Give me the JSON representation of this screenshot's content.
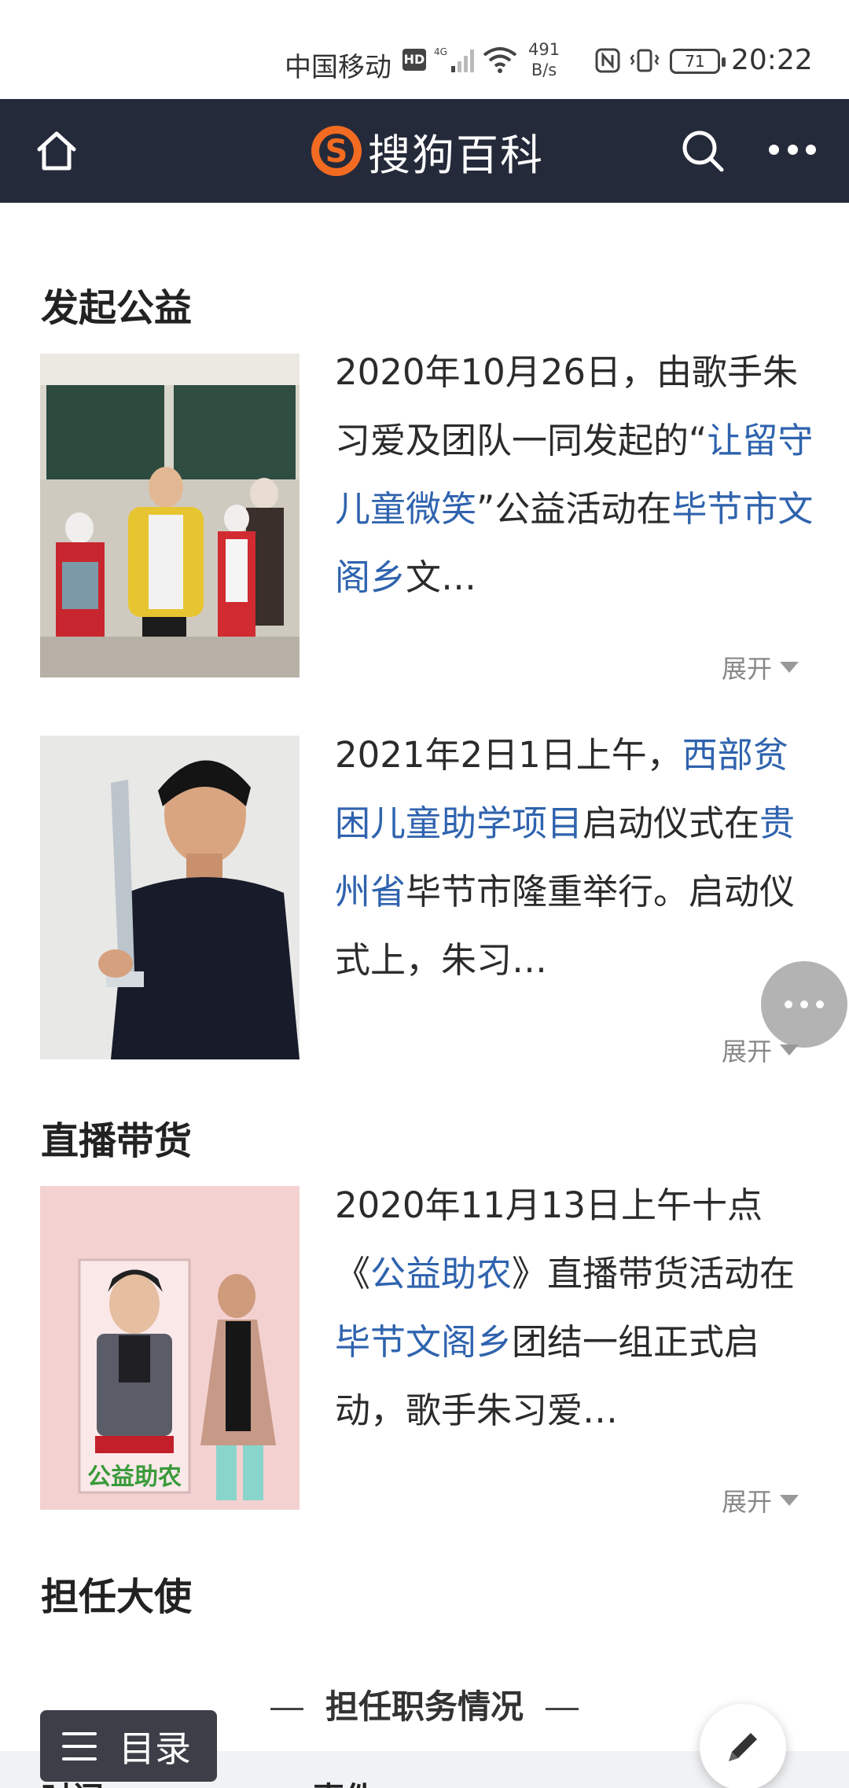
{
  "status_bar": {
    "carrier": "中国移动",
    "hd_badge": "HD",
    "network": "4G",
    "net_rate_value": "491",
    "net_rate_unit": "B/s",
    "battery_level": "71",
    "time": "20:22"
  },
  "navbar": {
    "logo_text": "搜狗百科",
    "colors": {
      "background": "#252a3a",
      "logo_orange": "#f26b21"
    }
  },
  "sections": [
    {
      "title": "发起公益"
    },
    {
      "title": "直播带货"
    },
    {
      "title": "担任大使"
    }
  ],
  "entries": [
    {
      "image_alt": "朱习爱与留守儿童合影",
      "parts": [
        {
          "text": "2020年10月26日，由歌手朱习爱及团队一同发起的“",
          "link": false
        },
        {
          "text": "让留守儿童微笑",
          "link": true
        },
        {
          "text": "”公益活动在",
          "link": false
        },
        {
          "text": "毕节市文阁乡",
          "link": true
        },
        {
          "text": "文…",
          "link": false
        }
      ],
      "expand_label": "展开"
    },
    {
      "image_alt": "朱习爱手持奖杯",
      "parts": [
        {
          "text": "2021年2日1日上午，",
          "link": false
        },
        {
          "text": "西部贫困儿童助学项目",
          "link": true
        },
        {
          "text": "启动仪式在",
          "link": false
        },
        {
          "text": "贵州省",
          "link": true
        },
        {
          "text": "毕节市隆重举行。启动仪式上，朱习…",
          "link": false
        }
      ],
      "expand_label": "展开"
    },
    {
      "image_alt": "公益助农直播展板",
      "banner_text": "公益助农",
      "parts": [
        {
          "text": "2020年11月13日上午十点《",
          "link": false
        },
        {
          "text": "公益助农",
          "link": true
        },
        {
          "text": "》直播带货活动在",
          "link": false
        },
        {
          "text": "毕节文阁乡",
          "link": true
        },
        {
          "text": "团结一组正式启动，歌手朱习爱…",
          "link": false
        }
      ],
      "expand_label": "展开"
    }
  ],
  "sub_heading": "担任职务情况",
  "table_header": {
    "col1": "时间",
    "col2": "事件"
  },
  "toc_label": "目录",
  "link_color": "#2f63ae"
}
